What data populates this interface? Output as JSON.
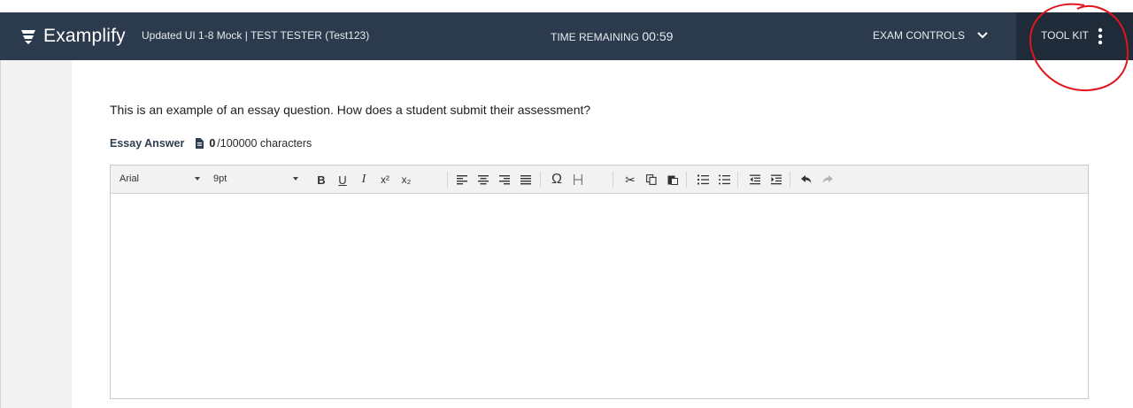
{
  "header": {
    "brand": "Examplify",
    "brand_tm": "·",
    "exam_title": "Updated UI 1-8 Mock | TEST TESTER (Test123)",
    "time_label": "TIME REMAINING",
    "time_value": "00:59",
    "exam_controls_label": "EXAM CONTROLS",
    "toolkit_label": "TOOL KIT"
  },
  "question": {
    "text": "This is an example of an essay question. How does a student submit their assessment?"
  },
  "answer": {
    "label": "Essay Answer",
    "char_count": "0",
    "char_total": "/100000 characters"
  },
  "toolbar": {
    "font_family": "Arial",
    "font_size": "9pt",
    "buttons": [
      {
        "name": "bold-button",
        "glyph": "B"
      },
      {
        "name": "underline-button",
        "glyph": "U"
      },
      {
        "name": "italic-button",
        "glyph": "I"
      },
      {
        "name": "superscript-button",
        "glyph": "x²"
      },
      {
        "name": "subscript-button",
        "glyph": "x₂"
      },
      {
        "name": "align-left-button",
        "glyph": "align-left-icon"
      },
      {
        "name": "align-center-button",
        "glyph": "align-center-icon"
      },
      {
        "name": "align-right-button",
        "glyph": "align-right-icon"
      },
      {
        "name": "align-justify-button",
        "glyph": "align-justify-icon"
      },
      {
        "name": "special-character-button",
        "glyph": "Ω"
      },
      {
        "name": "page-break-button",
        "glyph": "page-break-icon"
      },
      {
        "name": "cut-button",
        "glyph": "✂"
      },
      {
        "name": "copy-button",
        "glyph": "copy-icon"
      },
      {
        "name": "paste-button",
        "glyph": "paste-icon"
      },
      {
        "name": "numbered-list-button",
        "glyph": "numbered-list-icon"
      },
      {
        "name": "bulleted-list-button",
        "glyph": "bulleted-list-icon"
      },
      {
        "name": "outdent-button",
        "glyph": "outdent-icon"
      },
      {
        "name": "indent-button",
        "glyph": "indent-icon"
      },
      {
        "name": "undo-button",
        "glyph": "undo-icon"
      },
      {
        "name": "redo-button",
        "glyph": "redo-icon"
      }
    ]
  },
  "colors": {
    "header_bg": "#2b3a4c",
    "toolkit_bg": "#1f2b38",
    "annotation": "#e0161c"
  }
}
